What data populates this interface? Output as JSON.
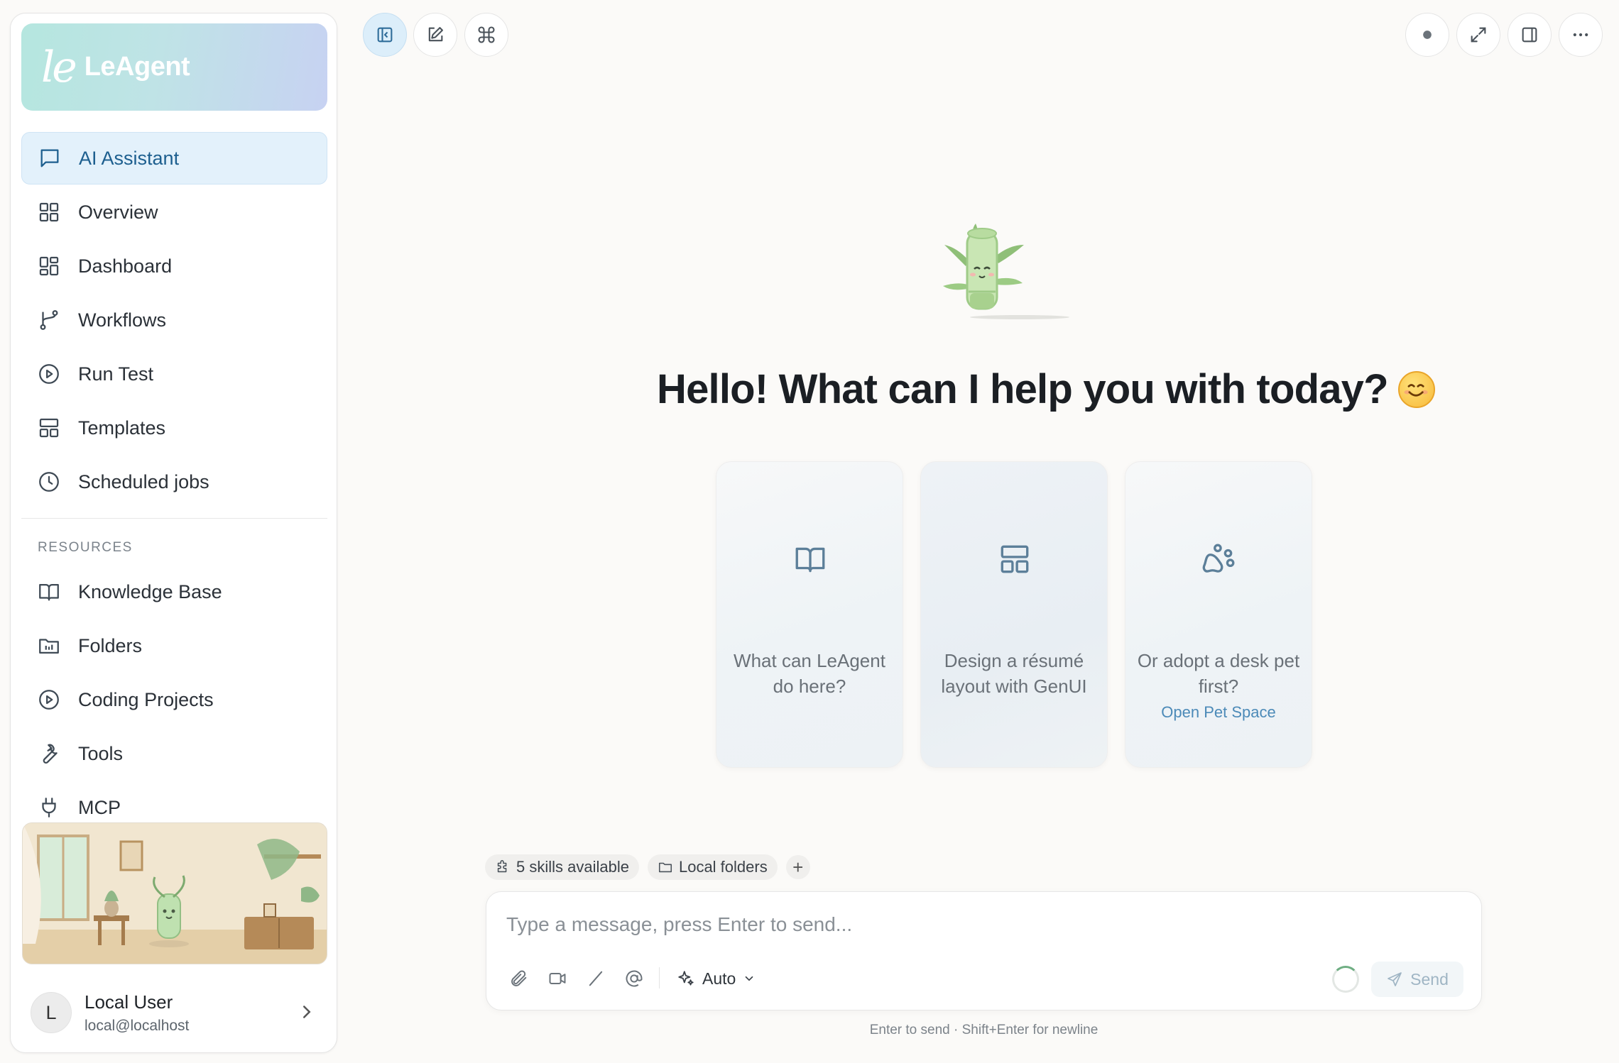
{
  "brand": {
    "mark": "le",
    "name": "LeAgent"
  },
  "nav": {
    "items": [
      {
        "label": "AI Assistant",
        "icon": "chat-icon",
        "active": true
      },
      {
        "label": "Overview",
        "icon": "grid-icon"
      },
      {
        "label": "Dashboard",
        "icon": "dashboard-icon"
      },
      {
        "label": "Workflows",
        "icon": "branch-icon"
      },
      {
        "label": "Run Test",
        "icon": "play-circle-icon"
      },
      {
        "label": "Templates",
        "icon": "layout-icon"
      },
      {
        "label": "Scheduled jobs",
        "icon": "clock-icon"
      }
    ],
    "resources_label": "RESOURCES",
    "resources": [
      {
        "label": "Knowledge Base",
        "icon": "book-icon"
      },
      {
        "label": "Folders",
        "icon": "folder-icon"
      },
      {
        "label": "Coding Projects",
        "icon": "play-circle-icon"
      },
      {
        "label": "Tools",
        "icon": "wrench-icon"
      },
      {
        "label": "MCP",
        "icon": "plug-icon"
      }
    ]
  },
  "user": {
    "initial": "L",
    "name": "Local User",
    "email": "local@localhost"
  },
  "main": {
    "greeting": "Hello! What can I help you with today?",
    "cards": [
      {
        "text": "What can LeAgent do here?",
        "icon": "book-open-icon"
      },
      {
        "text": "Design a résumé layout with GenUI",
        "icon": "layout-icon"
      },
      {
        "text": "Or adopt a desk pet first?",
        "link": "Open Pet Space",
        "icon": "paw-icon"
      }
    ]
  },
  "composer": {
    "skills_chip": "5 skills available",
    "folders_chip": "Local folders",
    "add_chip": "+",
    "placeholder": "Type a message, press Enter to send...",
    "model": "Auto",
    "send_label": "Send",
    "hint": "Enter to send · Shift+Enter for newline"
  },
  "colors": {
    "accent": "#1d5f8f",
    "active_bg": "#e3f1fb",
    "link": "#4c8ab8"
  }
}
